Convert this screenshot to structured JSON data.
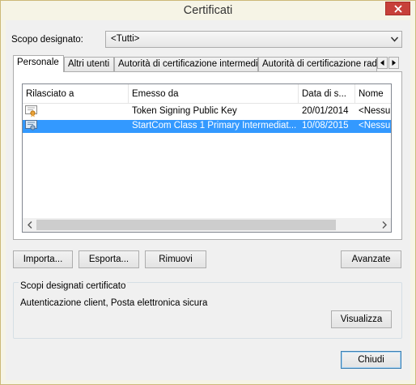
{
  "window": {
    "title": "Certificati"
  },
  "scope": {
    "label": "Scopo designato:",
    "value": "<Tutti>"
  },
  "tabs": [
    {
      "label": "Personale",
      "active": true
    },
    {
      "label": "Altri utenti",
      "active": false
    },
    {
      "label": "Autorità di certificazione intermedie",
      "active": false
    },
    {
      "label": "Autorità di certificazione radi",
      "active": false
    }
  ],
  "list": {
    "columns": [
      "Rilasciato a",
      "Emesso da",
      "Data di s...",
      "Nome"
    ],
    "rows": [
      {
        "issued_to": "",
        "issued_by": "Token Signing Public Key",
        "expiry": "20/01/2014",
        "name": "<Nessun",
        "selected": false
      },
      {
        "issued_to": "",
        "issued_by": "StartCom Class 1 Primary Intermediat...",
        "expiry": "10/08/2015",
        "name": "<Nessun",
        "selected": true
      }
    ]
  },
  "buttons": {
    "import": "Importa...",
    "export": "Esporta...",
    "remove": "Rimuovi",
    "advanced": "Avanzate",
    "view": "Visualizza",
    "close": "Chiudi"
  },
  "purposes_group": {
    "title": "Scopi designati certificato",
    "value": "Autenticazione client, Posta elettronica sicura"
  },
  "colors": {
    "selection": "#3399ff",
    "close_button": "#c7403a",
    "frame": "#f6f4e6"
  },
  "icons": [
    "close-icon",
    "chevron-down-icon",
    "certificate-icon",
    "arrow-left-icon",
    "arrow-right-icon"
  ]
}
